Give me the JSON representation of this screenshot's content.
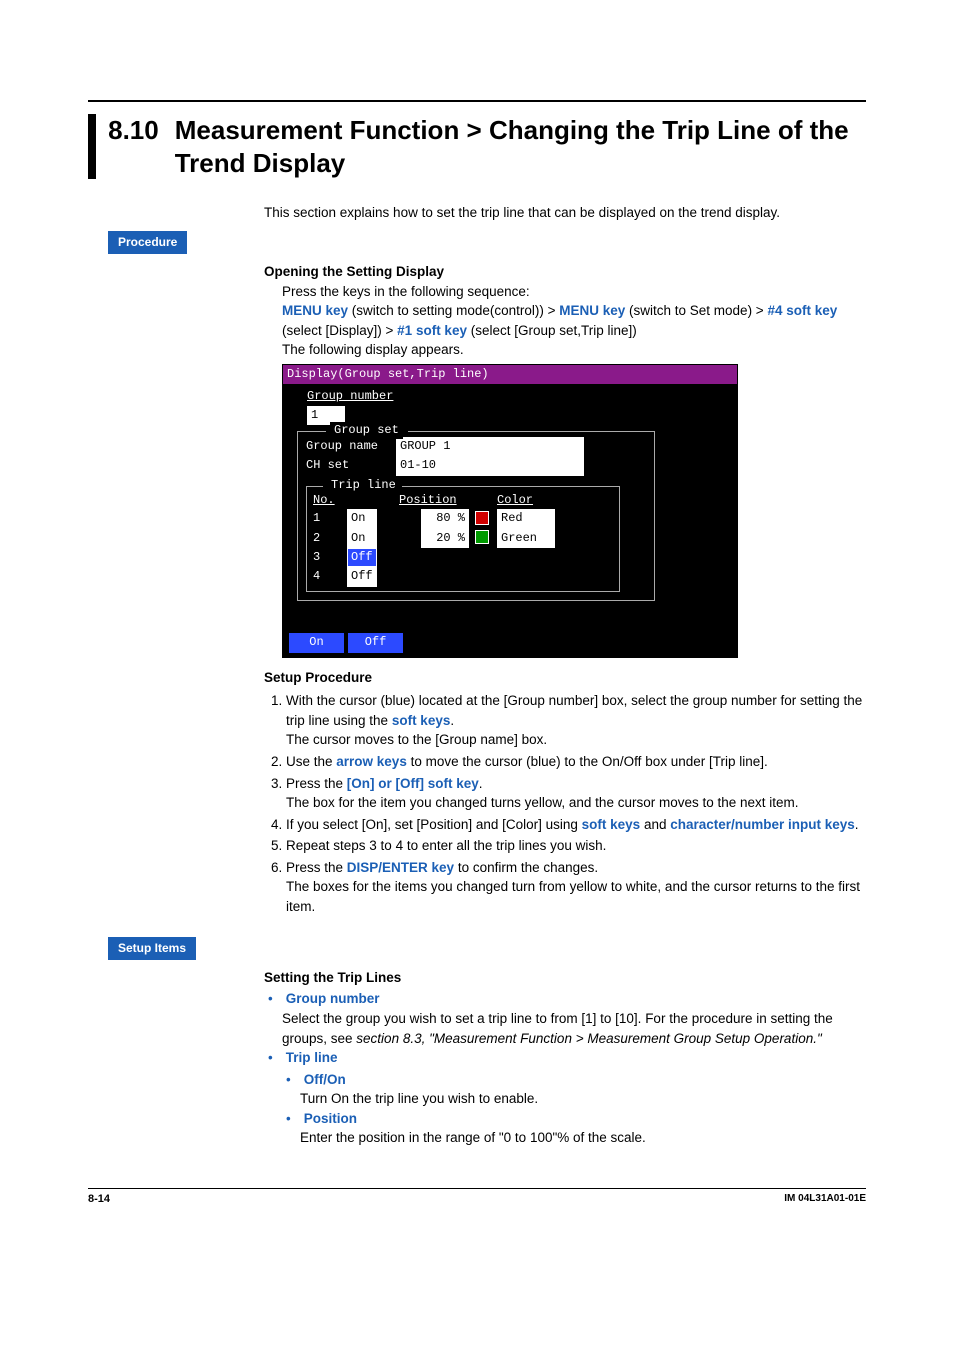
{
  "heading": {
    "number": "8.10",
    "title": "Measurement Function > Changing the Trip Line of the Trend Display"
  },
  "intro": "This section explains how to set the trip line that can be displayed on the trend display.",
  "badges": {
    "procedure": "Procedure",
    "setup_items": "Setup Items"
  },
  "opening": {
    "heading": "Opening the Setting Display",
    "press": "Press the keys in the following sequence:",
    "seq": {
      "k1": "MENU key",
      "t1": " (switch to setting mode(control)) > ",
      "k2": "MENU key",
      "t2": " (switch to Set mode) > ",
      "k3": "#4 soft key",
      "t3": " (select [Display]) > ",
      "k4": "#1 soft key",
      "t4": " (select [Group set,Trip line])"
    },
    "following": "The following display appears."
  },
  "screenshot": {
    "titlebar": "Display(Group set,Trip line)",
    "group_number_label": "Group number",
    "group_number_value": "1",
    "group_set_legend": "Group set",
    "group_name_label": "Group name",
    "group_name_value": "GROUP 1",
    "ch_set_label": "CH set",
    "ch_set_value": "01-10",
    "trip_line_legend": "Trip line",
    "headers": {
      "no": "No.",
      "position": "Position",
      "color": "Color"
    },
    "rows": [
      {
        "no": "1",
        "sw": "On",
        "pos": "80 %",
        "color_name": "Red",
        "color_hex": "#d00000"
      },
      {
        "no": "2",
        "sw": "On",
        "pos": "20 %",
        "color_name": "Green",
        "color_hex": "#009a00"
      },
      {
        "no": "3",
        "sw": "Off",
        "pos": "",
        "color_name": "",
        "color_hex": ""
      },
      {
        "no": "4",
        "sw": "Off",
        "pos": "",
        "color_name": "",
        "color_hex": ""
      }
    ],
    "softkeys": [
      "On",
      "Off"
    ]
  },
  "setup_procedure": {
    "heading": "Setup Procedure",
    "steps": [
      {
        "pre": "With the cursor (blue) located at the [Group number] box, select the group number for setting the trip line using the ",
        "key": "soft keys",
        "post": ".",
        "after": "The cursor moves to the [Group name] box."
      },
      {
        "pre": "Use the ",
        "key": "arrow keys",
        "post": " to move the cursor (blue) to the On/Off box under [Trip line]."
      },
      {
        "pre": "Press the ",
        "key": "[On] or [Off] soft key",
        "post": ".",
        "after": "The box for the item you changed turns yellow, and the cursor moves to the next item."
      },
      {
        "pre": "If you select [On], set [Position] and [Color] using ",
        "key": "soft keys",
        "mid": " and ",
        "key2": "character/number input keys",
        "post": "."
      },
      {
        "pre": "Repeat steps 3 to 4 to enter all the trip lines you wish."
      },
      {
        "pre": "Press the ",
        "key": "DISP/ENTER key",
        "post": " to confirm the changes.",
        "after": "The boxes for the items you changed turn from yellow to white, and the cursor returns to the first item."
      }
    ]
  },
  "setting_trip_lines": {
    "heading": "Setting the Trip Lines",
    "items": [
      {
        "title": "Group number",
        "text_pre": "Select the group you wish to set a trip line to from [1] to [10].  For the procedure in setting the groups, see ",
        "text_em": "section 8.3, \"Measurement Function > Measurement Group Setup Operation.\""
      },
      {
        "title": "Trip line",
        "sub": [
          {
            "title": "Off/On",
            "text": "Turn On the trip line you wish to enable."
          },
          {
            "title": "Position",
            "text": "Enter the position in the range of \"0 to 100\"% of the scale."
          }
        ]
      }
    ]
  },
  "footer": {
    "page": "8-14",
    "doc": "IM 04L31A01-01E"
  }
}
